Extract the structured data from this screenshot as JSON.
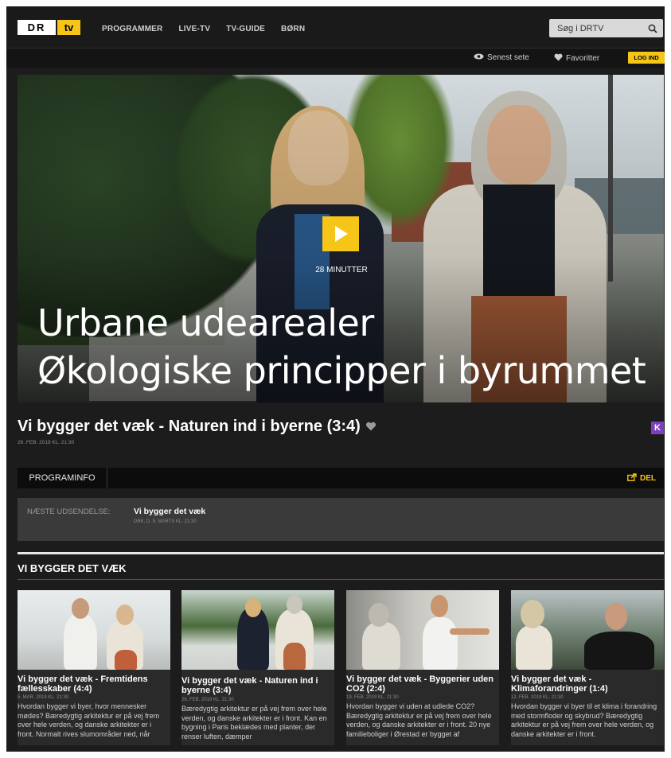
{
  "header": {
    "logo_dr": "DR",
    "logo_tv": "tv",
    "nav": [
      "PROGRAMMER",
      "LIVE-TV",
      "TV-GUIDE",
      "BØRN"
    ],
    "search_placeholder": "Søg i DRTV"
  },
  "subbar": {
    "recent": "Senest sete",
    "favorites": "Favoritter",
    "login": "LOG IND"
  },
  "hero": {
    "duration": "28 MINUTTER",
    "overlay_line1": "Urbane udearealer",
    "overlay_line2": "Økologiske principper i byrummet"
  },
  "program": {
    "title": "Vi bygger det væk - Naturen ind i byerne (3:4)",
    "date": "26. FEB. 2019 KL. 21:30",
    "badge": "K"
  },
  "tabs": {
    "info": "PROGRAMINFO",
    "share": "DEL"
  },
  "next": {
    "label": "NÆSTE UDSENDELSE:",
    "title": "Vi bygger det væk",
    "sub": "DRK, D. 5. MARTS KL. 21:30"
  },
  "series": {
    "title": "VI BYGGER DET VÆK",
    "episodes": [
      {
        "title": "Vi bygger det væk - Fremtidens fællesskaber (4:4)",
        "date": "5. MAR. 2019 KL. 21:30",
        "desc": "Hvordan bygger vi byer, hvor mennesker mødes? Bæredygtig arkitektur er på vej frem over hele verden, og danske arkitekter er i front. Normalt rives slumområder ned, når"
      },
      {
        "title": "Vi bygger det væk - Naturen ind i byerne (3:4)",
        "date": "26. FEB. 2019 KL. 21:30",
        "desc": "Bæredygtig arkitektur er på vej frem over hele verden, og danske arkitekter er i front. Kan en bygning i Paris beklædes med planter, der renser luften, dæmper"
      },
      {
        "title": "Vi bygger det væk - Byggerier uden CO2 (2:4)",
        "date": "19. FEB. 2019 KL. 21:30",
        "desc": "Hvordan bygger vi uden at udlede CO2? Bæredygtig arkitektur er på vej frem over hele verden, og danske arkitekter er i front. 20 nye familieboliger i Ørestad er bygget af"
      },
      {
        "title": "Vi bygger det væk - Klimaforandringer (1:4)",
        "date": "12. FEB. 2019 KL. 21:30",
        "desc": "Hvordan bygger vi byer til et klima i forandring med stormfloder og skybrud? Bæredygtig arkitektur er på vej frem over hele verden, og danske arkitekter er i front."
      }
    ]
  },
  "colors": {
    "accent": "#f5c518",
    "background": "#1c1c1c",
    "badge": "#7b3fbf"
  }
}
